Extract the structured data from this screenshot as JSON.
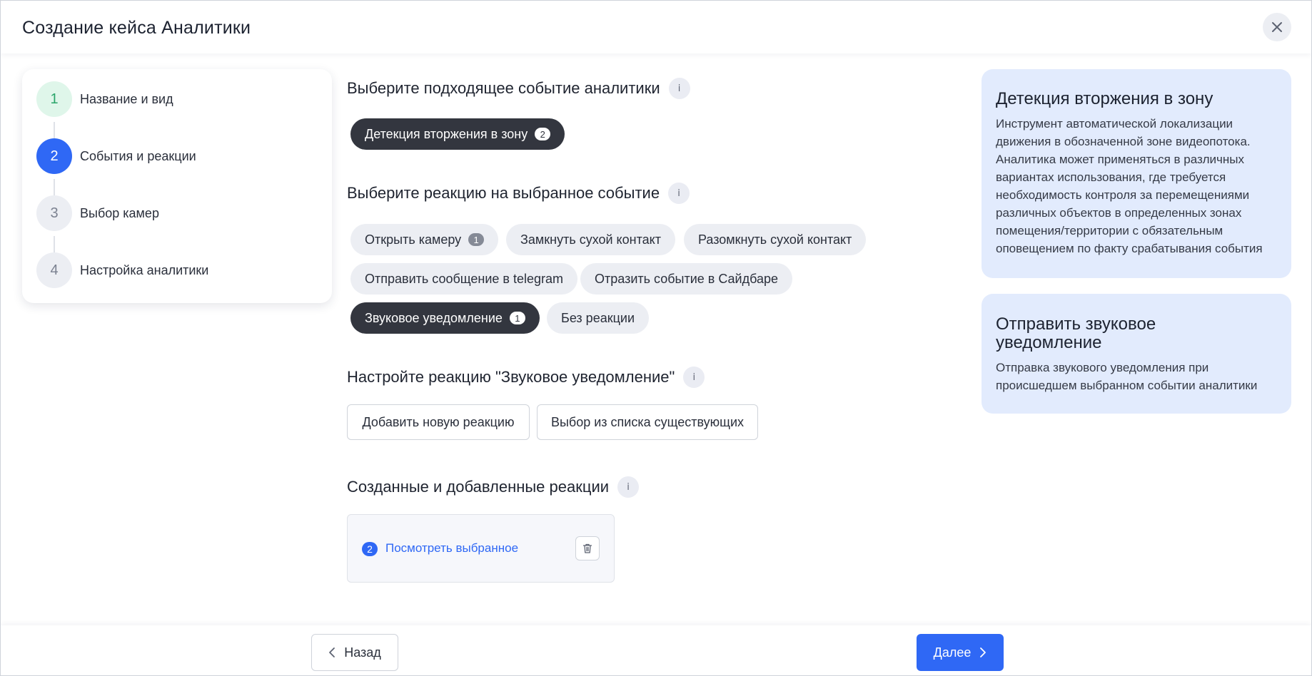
{
  "header": {
    "title": "Создание кейса Аналитики",
    "close_icon": "close-icon"
  },
  "stepper": {
    "steps": [
      {
        "number": "1",
        "label": "Название и вид",
        "state": "done"
      },
      {
        "number": "2",
        "label": "События и реакции",
        "state": "active"
      },
      {
        "number": "3",
        "label": "Выбор камер",
        "state": "todo"
      },
      {
        "number": "4",
        "label": "Настройка аналитики",
        "state": "todo"
      }
    ]
  },
  "events_section": {
    "title": "Выберите подходящее событие аналитики",
    "info_icon": "i",
    "chips": [
      {
        "label": "Детекция вторжения в зону",
        "badge": "2",
        "selected": true
      }
    ]
  },
  "reactions_section": {
    "title": "Выберите реакцию на выбранное событие",
    "info_icon": "i",
    "chips": [
      {
        "label": "Открыть камеру",
        "badge": "1",
        "selected": false
      },
      {
        "label": "Замкнуть сухой контакт",
        "selected": false
      },
      {
        "label": "Разомкнуть сухой контакт",
        "selected": false
      },
      {
        "label": "Отправить сообщение в telegram",
        "selected": false
      },
      {
        "label": "Отразить событие в Сайдбаре",
        "selected": false
      },
      {
        "label": "Звуковое уведомление",
        "badge": "1",
        "selected": true
      },
      {
        "label": "Без реакции",
        "selected": false
      }
    ]
  },
  "configure_section": {
    "title": "Настройте реакцию \"Звуковое уведомление\"",
    "info_icon": "i",
    "add_new_label": "Добавить новую реакцию",
    "choose_existing_label": "Выбор из списка существующих"
  },
  "created_section": {
    "title": "Созданные и добавленные реакции",
    "info_icon": "i",
    "count": "2",
    "view_link": "Посмотреть выбранное",
    "delete_icon": "trash-icon"
  },
  "info_panels": [
    {
      "title": "Детекция вторжения в зону",
      "lines": [
        "Инструмент автоматической локализации",
        "движения в обозначенной зоне видеопотока.",
        "Аналитика может применяться в различных",
        "вариантах использования, где требуется",
        "необходимость контроля за перемещениями",
        "различных объектов в определенных зонах",
        "помещения/территории с обязательным",
        "оповещением по факту срабатывания события"
      ]
    },
    {
      "title_lines": [
        "Отправить звуковое",
        "уведомление"
      ],
      "lines": [
        "Отправка звукового уведомления при",
        "происшедшем выбранном событии аналитики"
      ]
    }
  ],
  "footer": {
    "back_label": "Назад",
    "next_label": "Далее",
    "back_icon": "chevron-left-icon",
    "next_icon": "chevron-right-icon"
  },
  "colors": {
    "accent": "#2f68f5",
    "selected_chip": "#33363f",
    "chip": "#eceef3",
    "step_done_bg": "#dff6ea",
    "step_done_text": "#2aa56a",
    "info_panel_bg": "#e2ebfd"
  }
}
